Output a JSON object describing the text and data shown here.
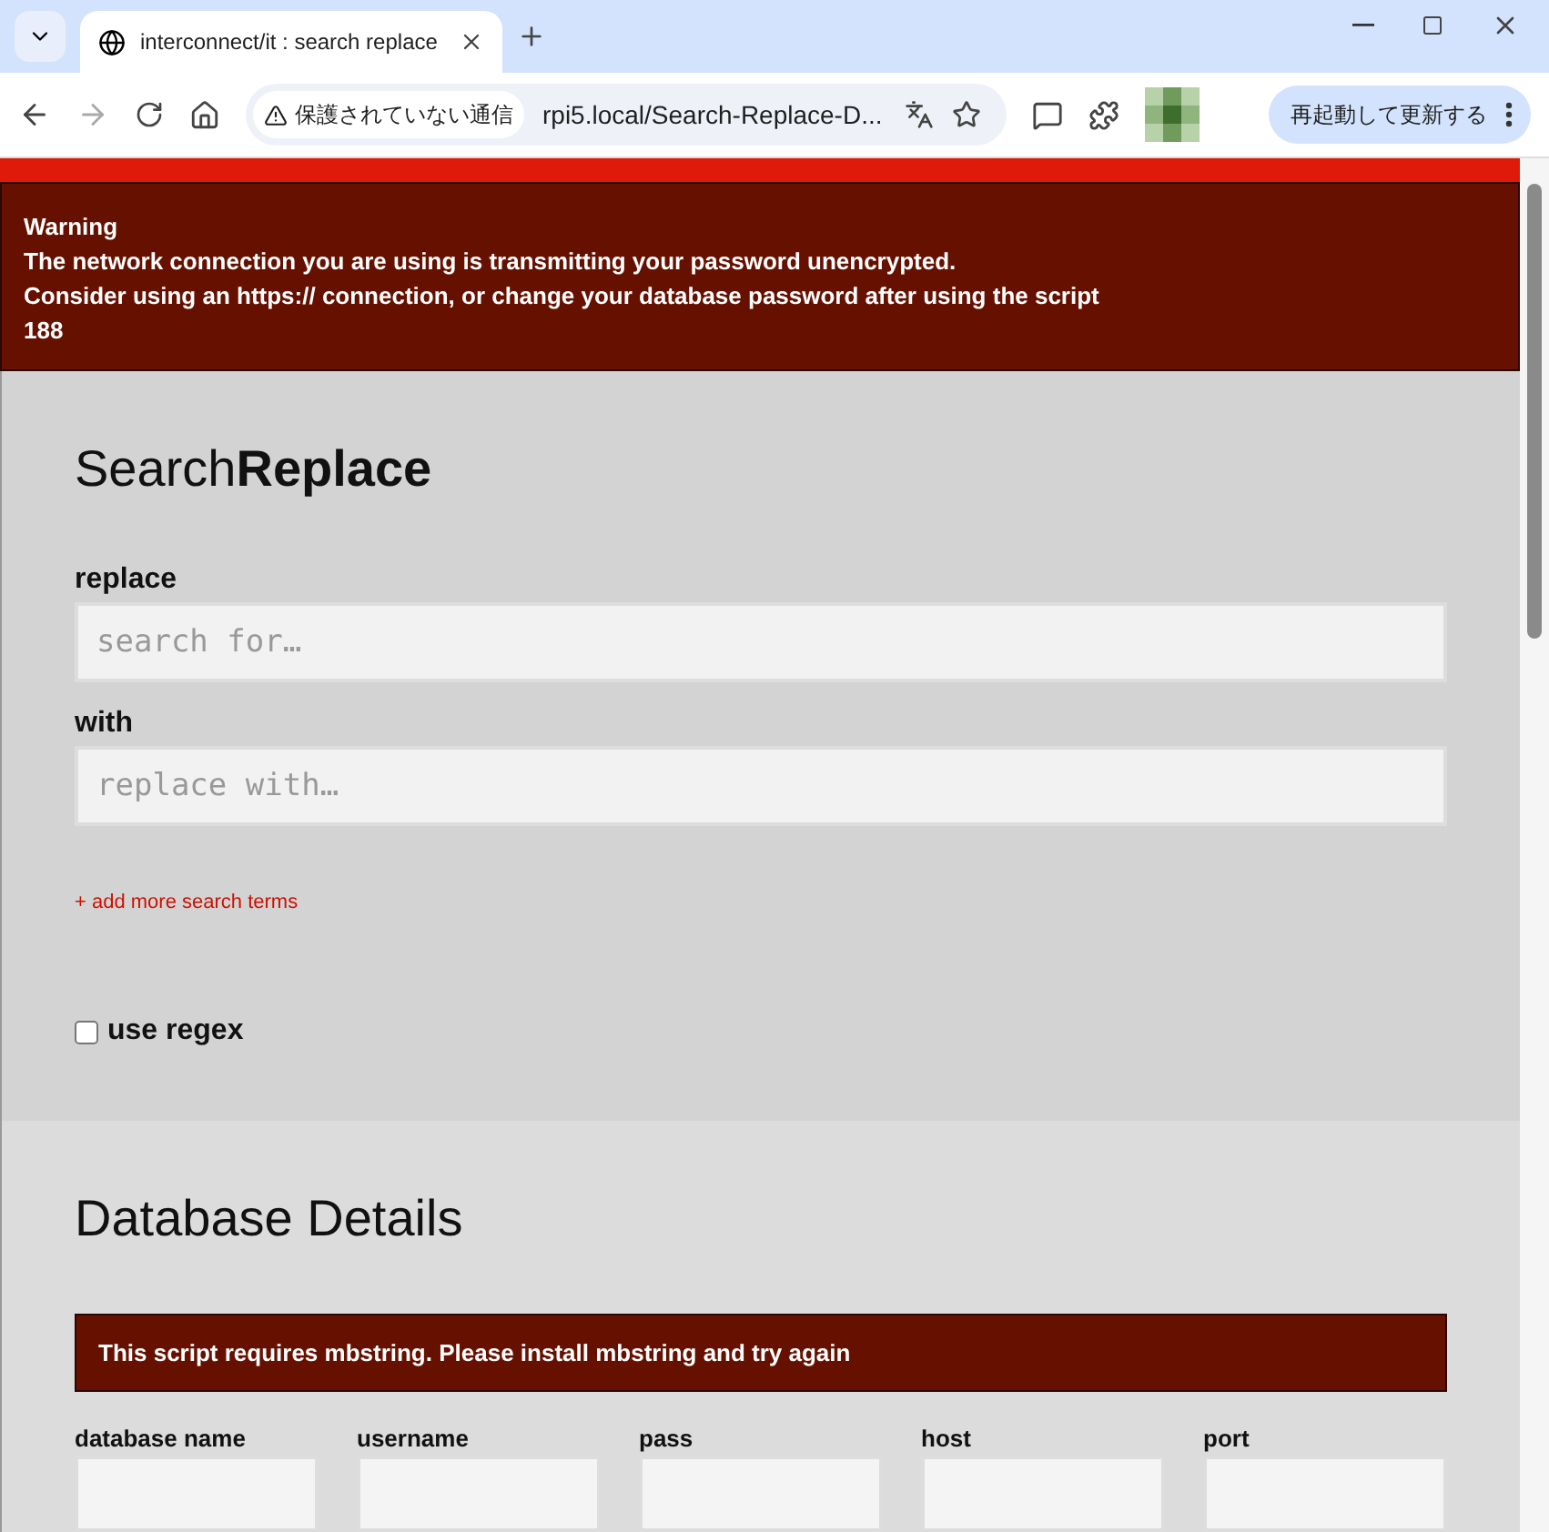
{
  "browser": {
    "tab_title": "interconnect/it : search replace",
    "security_label": "保護されていない通信",
    "url": "rpi5.local/Search-Replace-D...",
    "update_button": "再起動して更新する"
  },
  "warning": {
    "lines": [
      "Warning",
      "The network connection you are using is transmitting your password unencrypted.",
      "Consider using an https:// connection, or change your database password after using the script",
      "188"
    ]
  },
  "search_replace": {
    "title_light": "Search",
    "title_bold": "Replace",
    "fields": [
      {
        "label": "replace",
        "placeholder": "search for…"
      },
      {
        "label": "with",
        "placeholder": "replace with…"
      }
    ],
    "add_link": "+ add more search terms",
    "regex": {
      "label": "use regex",
      "checked": false
    }
  },
  "database": {
    "title": "Database Details",
    "error": "This script requires mbstring. Please install mbstring and try again",
    "fields": [
      {
        "label": "database name"
      },
      {
        "label": "username"
      },
      {
        "label": "pass"
      },
      {
        "label": "host"
      },
      {
        "label": "port"
      }
    ]
  }
}
